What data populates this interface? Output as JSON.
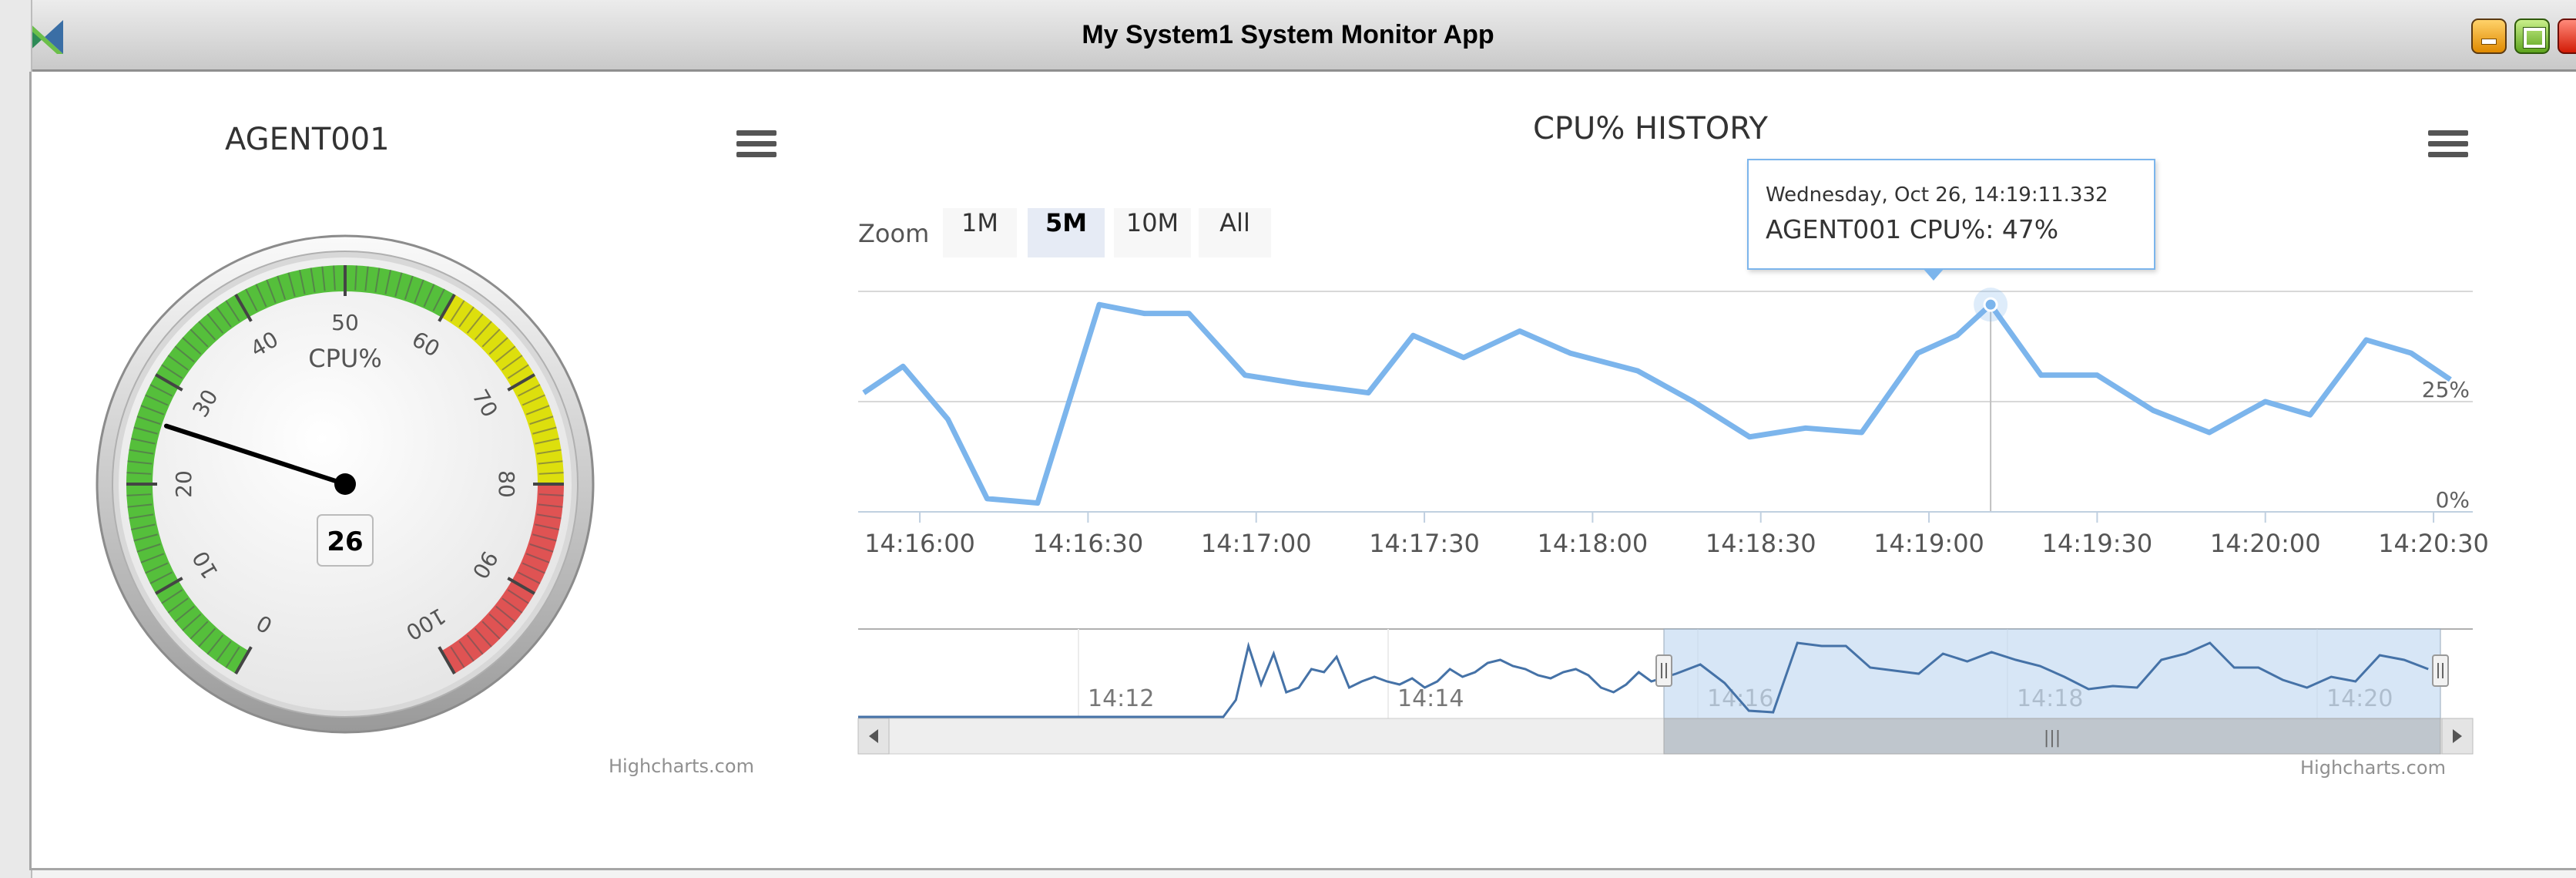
{
  "window": {
    "title": "My System1 System Monitor App"
  },
  "gauge": {
    "title": "AGENT001",
    "unit_label": "CPU%",
    "value": 26,
    "min": 0,
    "max": 100,
    "tick_labels": [
      "0",
      "10",
      "20",
      "30",
      "40",
      "50",
      "60",
      "70",
      "80",
      "90",
      "100"
    ],
    "bands": [
      {
        "from": 0,
        "to": 60,
        "color": "#55BF3B"
      },
      {
        "from": 60,
        "to": 80,
        "color": "#DDDF0D"
      },
      {
        "from": 80,
        "to": 100,
        "color": "#DF5353"
      }
    ],
    "credit": "Highcharts.com"
  },
  "history": {
    "title": "CPU% HISTORY",
    "zoom": {
      "label": "Zoom",
      "buttons": [
        "1M",
        "5M",
        "10M",
        "All"
      ],
      "selected": "5M"
    },
    "tooltip": {
      "date": "Wednesday, Oct 26, 14:19:11.332",
      "series": "AGENT001 CPU%:",
      "value": "47%"
    },
    "credit": "Highcharts.com",
    "navigator_labels": [
      "14:12",
      "14:14",
      "14:16",
      "14:18",
      "14:20"
    ],
    "scrollbar_grip": "|||",
    "line_color": "#7cb5ec"
  },
  "chart_data": [
    {
      "type": "gauge",
      "title": "AGENT001",
      "label": "CPU%",
      "value": 26,
      "min": 0,
      "max": 100
    },
    {
      "type": "line",
      "title": "CPU% HISTORY",
      "series": [
        {
          "name": "AGENT001 CPU%",
          "x": [
            "14:15:50",
            "14:15:57",
            "14:16:05",
            "14:16:12",
            "14:16:21",
            "14:16:32",
            "14:16:40",
            "14:16:48",
            "14:16:58",
            "14:17:08",
            "14:17:20",
            "14:17:28",
            "14:17:37",
            "14:17:47",
            "14:17:56",
            "14:18:08",
            "14:18:18",
            "14:18:28",
            "14:18:38",
            "14:18:48",
            "14:18:58",
            "14:19:05",
            "14:19:11",
            "14:19:20",
            "14:19:30",
            "14:19:40",
            "14:19:50",
            "14:20:00",
            "14:20:08",
            "14:20:18",
            "14:20:26",
            "14:20:33"
          ],
          "values": [
            27,
            33,
            21,
            3,
            2,
            47,
            45,
            45,
            31,
            29,
            27,
            40,
            35,
            41,
            36,
            32,
            25,
            17,
            19,
            18,
            36,
            40,
            47,
            31,
            31,
            23,
            18,
            25,
            22,
            39,
            36,
            30
          ]
        }
      ],
      "x_tick_labels": [
        "14:16:00",
        "14:16:30",
        "14:17:00",
        "14:17:30",
        "14:18:00",
        "14:18:30",
        "14:19:00",
        "14:19:30",
        "14:20:00",
        "14:20:30"
      ],
      "y_tick_labels": [
        "0%",
        "25%"
      ],
      "ylim": [
        0,
        50
      ],
      "grid": true,
      "legend": "none"
    }
  ]
}
